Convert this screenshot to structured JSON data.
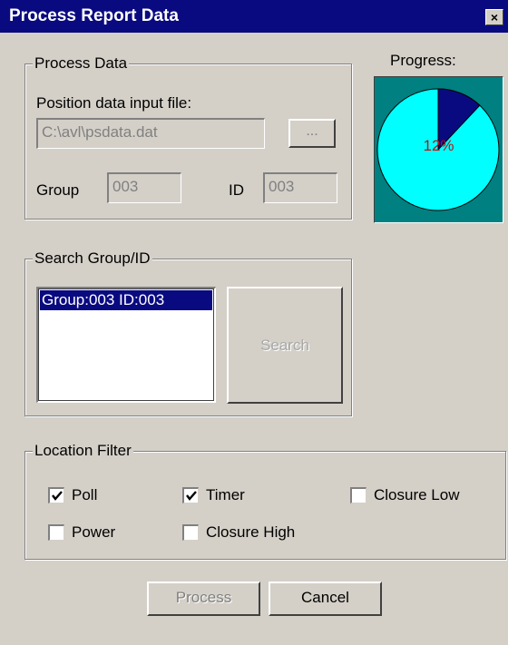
{
  "window": {
    "title": "Process Report Data",
    "close_glyph": "×"
  },
  "process_data": {
    "legend": "Process Data",
    "file_label": "Position data input file:",
    "file_value": "C:\\avl\\psdata.dat",
    "browse_label": "...",
    "group_label": "Group",
    "group_value": "003",
    "id_label": "ID",
    "id_value": "003"
  },
  "progress": {
    "label": "Progress:",
    "percent": 12,
    "percent_text": "12%",
    "colors": {
      "background": "#008080",
      "complete": "#0a0a80",
      "remaining": "#00ffff",
      "text": "#c01010"
    }
  },
  "search": {
    "legend": "Search Group/ID",
    "items": [
      "Group:003  ID:003"
    ],
    "button_label": "Search"
  },
  "location_filter": {
    "legend": "Location Filter",
    "poll": {
      "label": "Poll",
      "checked": true
    },
    "timer": {
      "label": "Timer",
      "checked": true
    },
    "closure_low": {
      "label": "Closure Low",
      "checked": false
    },
    "power": {
      "label": "Power",
      "checked": false
    },
    "closure_high": {
      "label": "Closure High",
      "checked": false
    }
  },
  "actions": {
    "process_label": "Process",
    "cancel_label": "Cancel"
  },
  "theme": {
    "title_bar": "#0a0a80",
    "face": "#d4d0c8",
    "selection": "#0a0a80"
  }
}
